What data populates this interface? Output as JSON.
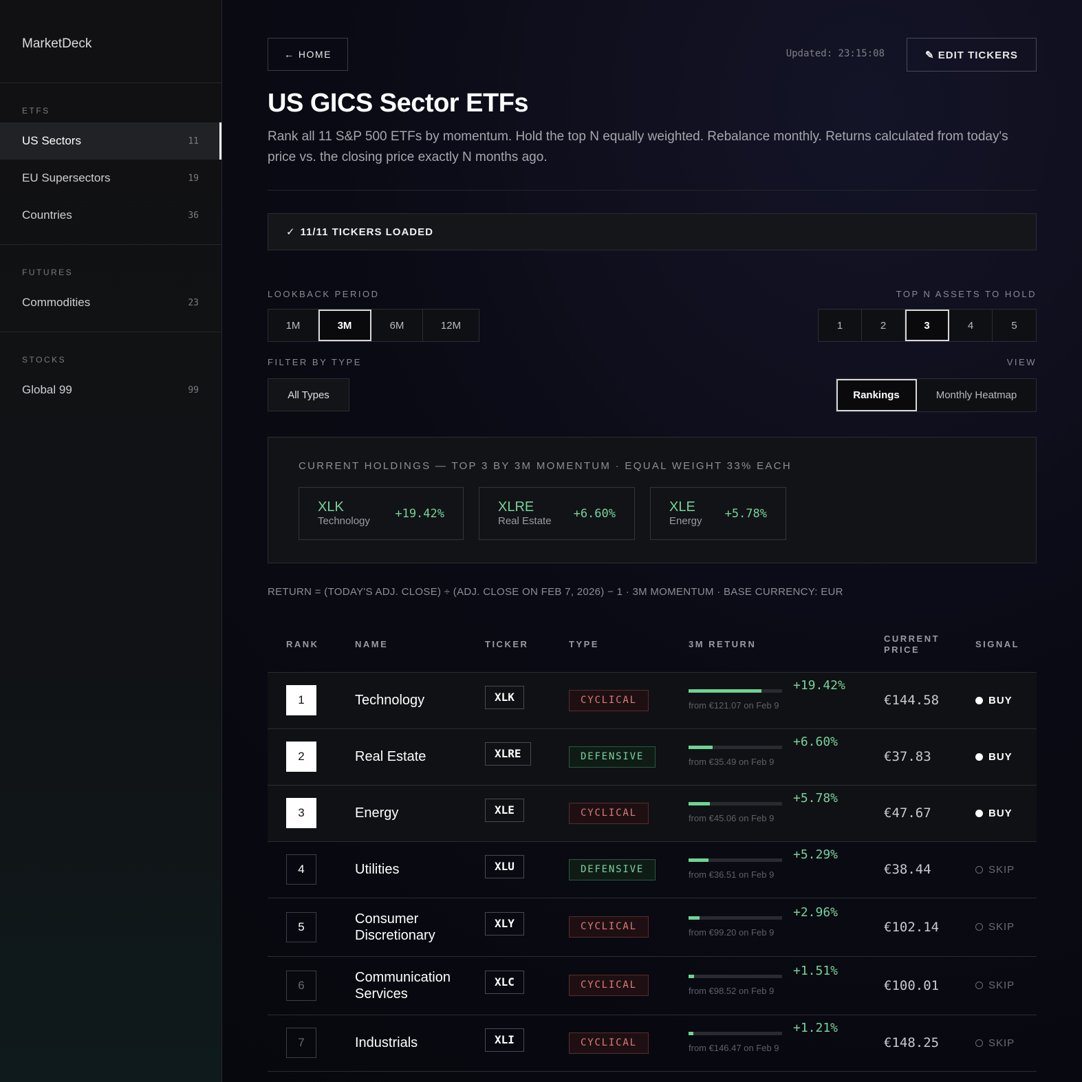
{
  "app": {
    "brand": "MarketDeck"
  },
  "sidebar": {
    "groups": [
      {
        "label": "ETFS",
        "items": [
          {
            "label": "US Sectors",
            "count": "11",
            "active": true
          },
          {
            "label": "EU Supersectors",
            "count": "19"
          },
          {
            "label": "Countries",
            "count": "36"
          }
        ]
      },
      {
        "label": "FUTURES",
        "items": [
          {
            "label": "Commodities",
            "count": "23"
          }
        ]
      },
      {
        "label": "STOCKS",
        "items": [
          {
            "label": "Global 99",
            "count": "99"
          }
        ]
      }
    ]
  },
  "header": {
    "home_label": "← HOME",
    "updated": "Updated: 23:15:08",
    "edit_label": "✎ EDIT TICKERS",
    "title": "US GICS Sector ETFs",
    "description": "Rank all 11 S&P 500 ETFs by momentum. Hold the top N equally weighted. Rebalance monthly. Returns calculated from today's price vs. the closing price exactly N months ago."
  },
  "status": {
    "check": "✓",
    "text": "11/11 TICKERS LOADED"
  },
  "controls": {
    "lookback_label": "LOOKBACK PERIOD",
    "lookback_options": [
      "1M",
      "3M",
      "6M",
      "12M"
    ],
    "lookback_selected": "3M",
    "topn_label": "TOP N ASSETS TO HOLD",
    "topn_options": [
      "1",
      "2",
      "3",
      "4",
      "5"
    ],
    "topn_selected": "3",
    "filter_label": "FILTER BY TYPE",
    "filter_value": "All Types",
    "view_label": "VIEW",
    "view_options": [
      "Rankings",
      "Monthly Heatmap"
    ],
    "view_selected": "Rankings"
  },
  "holdings": {
    "title": "CURRENT HOLDINGS — TOP 3 BY 3M MOMENTUM · EQUAL WEIGHT 33% EACH",
    "cards": [
      {
        "ticker": "XLK",
        "name": "Technology",
        "return": "+19.42%"
      },
      {
        "ticker": "XLRE",
        "name": "Real Estate",
        "return": "+6.60%"
      },
      {
        "ticker": "XLE",
        "name": "Energy",
        "return": "+5.78%"
      }
    ]
  },
  "formula": "RETURN = (TODAY'S ADJ. CLOSE) ÷ (ADJ. CLOSE ON FEB 7, 2026) − 1 · 3M MOMENTUM · BASE CURRENCY: EUR",
  "table": {
    "headers": {
      "rank": "RANK",
      "name": "NAME",
      "ticker": "TICKER",
      "type": "TYPE",
      "return": "3M RETURN",
      "price_line1": "CURRENT",
      "price_line2": "PRICE",
      "signal": "SIGNAL"
    },
    "rows": [
      {
        "rank": "1",
        "name": "Technology",
        "ticker": "XLK",
        "type": "CYCLICAL",
        "return": "+19.42%",
        "bar": 0.78,
        "from": "from €121.07 on Feb 9",
        "price": "€144.58",
        "signal": "BUY"
      },
      {
        "rank": "2",
        "name": "Real Estate",
        "ticker": "XLRE",
        "type": "DEFENSIVE",
        "return": "+6.60%",
        "bar": 0.26,
        "from": "from €35.49 on Feb 9",
        "price": "€37.83",
        "signal": "BUY"
      },
      {
        "rank": "3",
        "name": "Energy",
        "ticker": "XLE",
        "type": "CYCLICAL",
        "return": "+5.78%",
        "bar": 0.23,
        "from": "from €45.06 on Feb 9",
        "price": "€47.67",
        "signal": "BUY"
      },
      {
        "rank": "4",
        "name": "Utilities",
        "ticker": "XLU",
        "type": "DEFENSIVE",
        "return": "+5.29%",
        "bar": 0.21,
        "from": "from €36.51 on Feb 9",
        "price": "€38.44",
        "signal": "SKIP"
      },
      {
        "rank": "5",
        "name_line1": "Consumer",
        "name_line2": "Discretionary",
        "ticker": "XLY",
        "type": "CYCLICAL",
        "return": "+2.96%",
        "bar": 0.12,
        "from": "from €99.20 on Feb 9",
        "price": "€102.14",
        "signal": "SKIP"
      },
      {
        "rank": "6",
        "name_line1": "Communication",
        "name_line2": "Services",
        "ticker": "XLC",
        "type": "CYCLICAL",
        "return": "+1.51%",
        "bar": 0.06,
        "from": "from €98.52 on Feb 9",
        "price": "€100.01",
        "signal": "SKIP"
      },
      {
        "rank": "7",
        "name": "Industrials",
        "ticker": "XLI",
        "type": "CYCLICAL",
        "return": "+1.21%",
        "bar": 0.05,
        "from": "from €146.47 on Feb 9",
        "price": "€148.25",
        "signal": "SKIP"
      }
    ]
  }
}
